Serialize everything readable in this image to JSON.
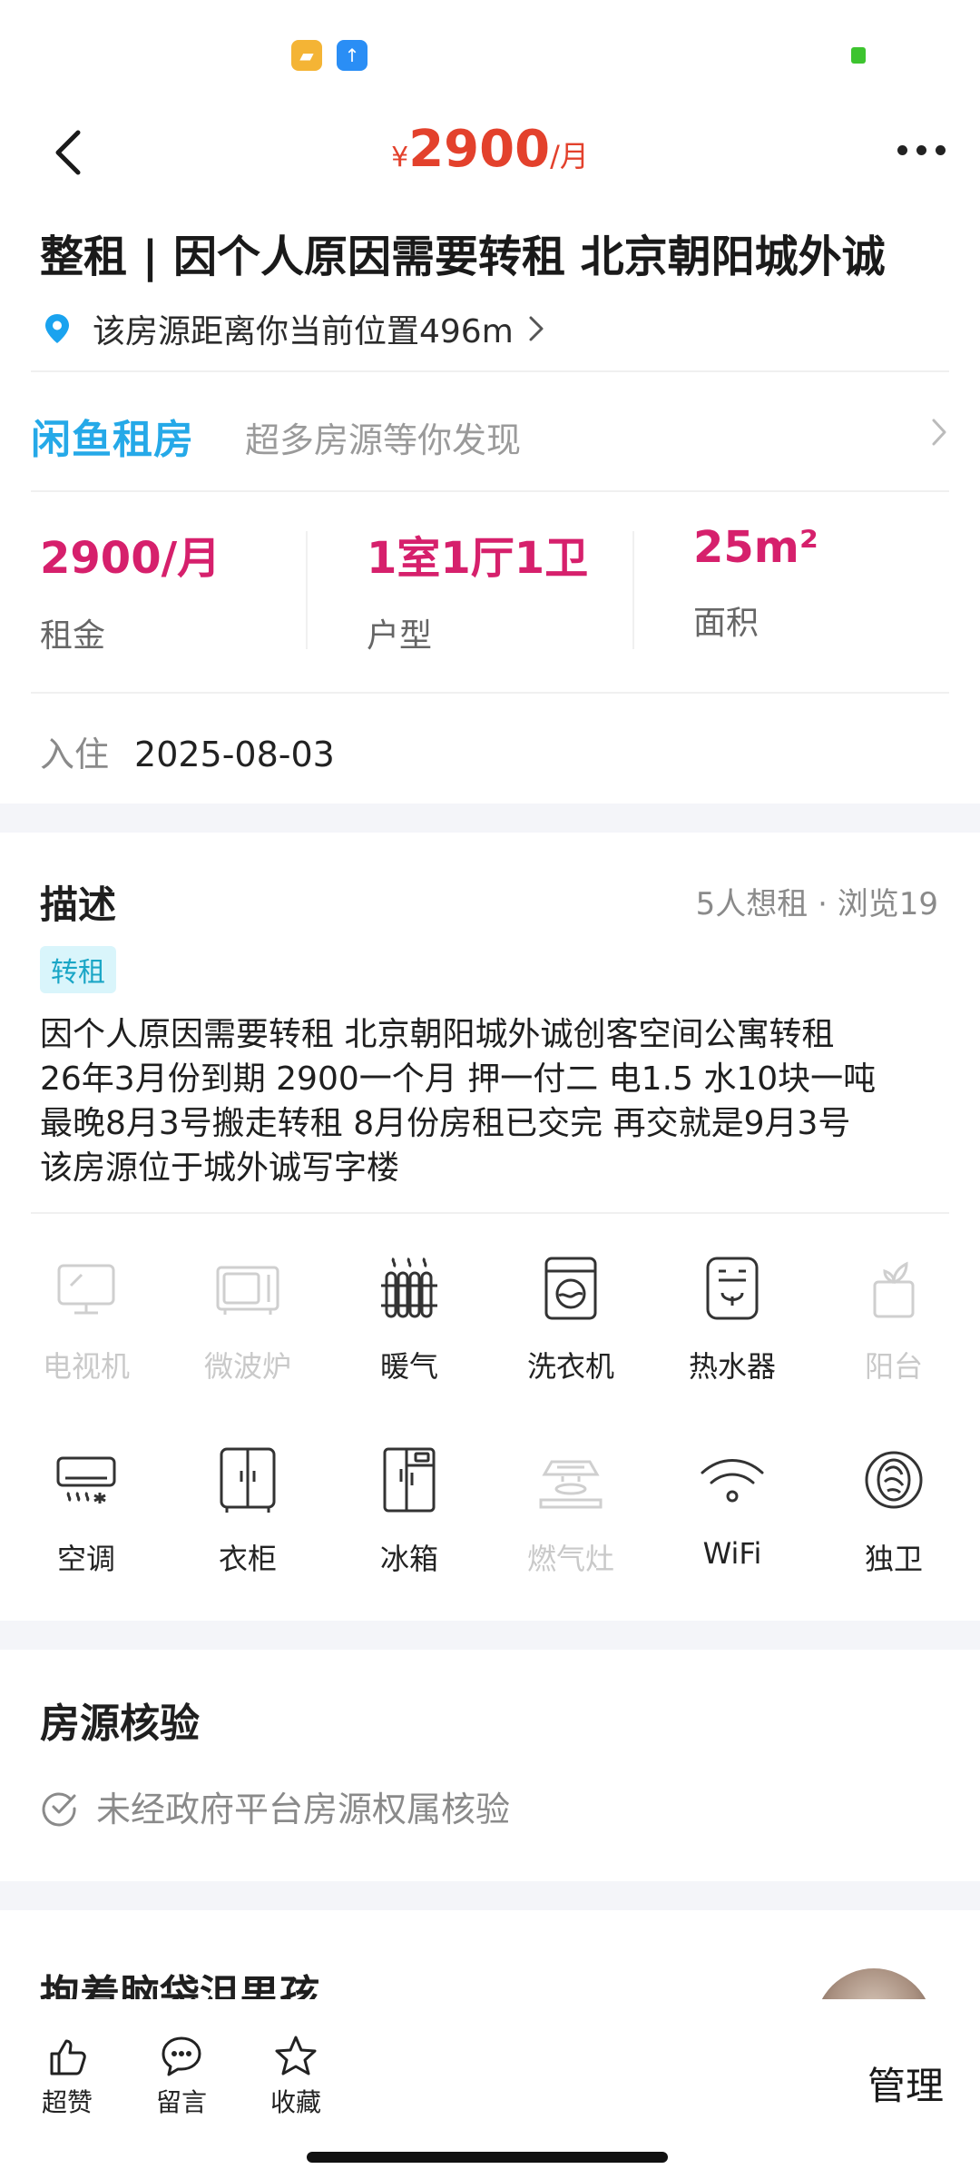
{
  "status_bar": {
    "icon_a": "note-app-icon",
    "icon_b": "upload-app-icon",
    "battery": "battery-icon"
  },
  "header": {
    "currency": "¥",
    "price": "2900",
    "unit": "/月",
    "back_icon": "back-chevron-icon",
    "more_icon": "more-dots-icon"
  },
  "listing": {
    "title": "整租 | 因个人原因需要转租 北京朝阳城外诚",
    "location_text": "该房源距离你当前位置496m"
  },
  "brand": {
    "logo_text": "闲鱼租房",
    "slogan": "超多房源等你发现"
  },
  "stats": [
    {
      "value": "2900/月",
      "label": "租金"
    },
    {
      "value": "1室1厅1卫",
      "label": "户型"
    },
    {
      "value": "25m²",
      "label": "面积"
    }
  ],
  "move_in": {
    "label": "入住",
    "date": "2025-08-03"
  },
  "description": {
    "title": "描述",
    "meta": "5人想租 · 浏览19",
    "tag": "转租",
    "lines": [
      "因个人原因需要转租 北京朝阳城外诚创客空间公寓转租",
      "26年3月份到期 2900一个月 押一付二 电1.5 水10块一吨",
      "最晚8月3号搬走转租 8月份房租已交完 再交就是9月3号",
      "该房源位于城外诚写字楼"
    ]
  },
  "amenities": [
    {
      "name": "电视机",
      "icon": "tv-icon",
      "available": false
    },
    {
      "name": "微波炉",
      "icon": "microwave-icon",
      "available": false
    },
    {
      "name": "暖气",
      "icon": "radiator-icon",
      "available": true
    },
    {
      "name": "洗衣机",
      "icon": "washing-machine-icon",
      "available": true
    },
    {
      "name": "热水器",
      "icon": "water-heater-icon",
      "available": true
    },
    {
      "name": "阳台",
      "icon": "balcony-plant-icon",
      "available": false
    },
    {
      "name": "空调",
      "icon": "air-conditioner-icon",
      "available": true
    },
    {
      "name": "衣柜",
      "icon": "wardrobe-icon",
      "available": true
    },
    {
      "name": "冰箱",
      "icon": "fridge-icon",
      "available": true
    },
    {
      "name": "燃气灶",
      "icon": "gas-stove-icon",
      "available": false
    },
    {
      "name": "WiFi",
      "icon": "wifi-icon",
      "available": true
    },
    {
      "name": "独卫",
      "icon": "private-bathroom-icon",
      "available": true
    }
  ],
  "verification": {
    "title": "房源核验",
    "status": "未经政府平台房源权属核验"
  },
  "seller_section": {
    "title": "抱着脑袋沮男孩"
  },
  "bottom_bar": {
    "like": "超赞",
    "comment": "留言",
    "favorite": "收藏",
    "manage": "管理"
  },
  "colors": {
    "price_red": "#e3412c",
    "stat_pink": "#d6206c",
    "brand_blue": "#25a9e8",
    "tag_bg": "#d9f5fb",
    "tag_text": "#1aa6c6"
  }
}
